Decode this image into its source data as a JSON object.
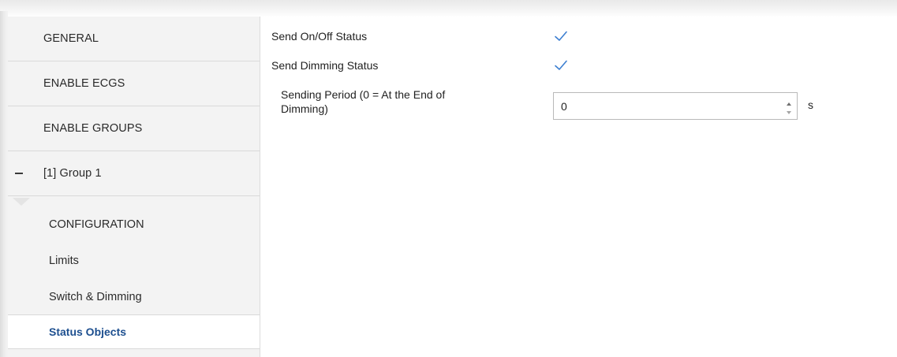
{
  "sidebar": {
    "items": [
      {
        "label": "GENERAL"
      },
      {
        "label": "ENABLE ECGS"
      },
      {
        "label": "ENABLE GROUPS"
      },
      {
        "label": "[1] Group 1"
      }
    ],
    "sub_items": [
      {
        "label": "CONFIGURATION"
      },
      {
        "label": "Limits"
      },
      {
        "label": "Switch & Dimming"
      },
      {
        "label": "Status Objects",
        "active": true
      }
    ]
  },
  "content": {
    "params": [
      {
        "label": "Send On/Off Status",
        "checked": true
      },
      {
        "label": "Send Dimming Status",
        "checked": true
      }
    ],
    "sending_period": {
      "label_line1": "Sending Period (0 = At the End of",
      "label_line2": "Dimming)",
      "value": "0",
      "unit": "s"
    }
  },
  "colors": {
    "accent": "#1d4f8f",
    "checkmark": "#3d7fd1",
    "sidebar_bg": "#f3f3f3"
  },
  "icons": {
    "checkbox": "check-icon",
    "collapse": "minus-icon",
    "spin_up": "triangle-up-icon",
    "spin_down": "triangle-down-icon"
  }
}
